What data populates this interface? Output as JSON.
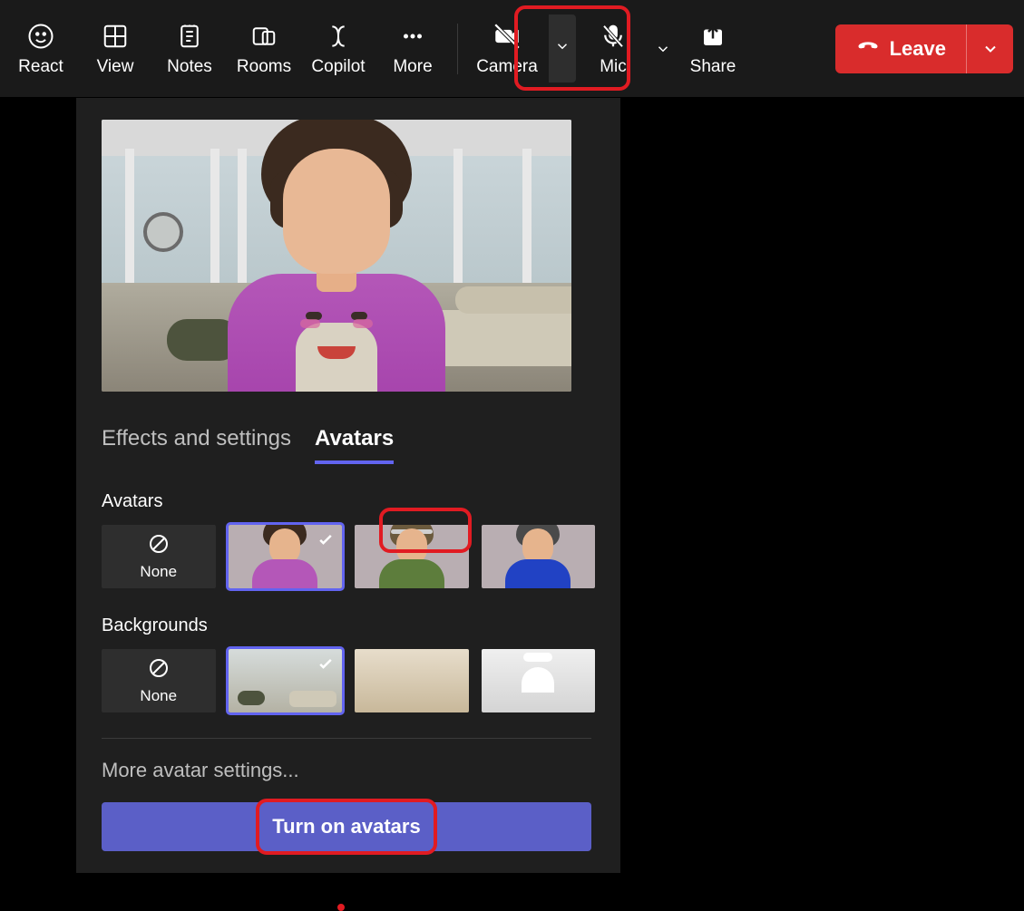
{
  "toolbar": {
    "react": "React",
    "view": "View",
    "notes": "Notes",
    "rooms": "Rooms",
    "copilot": "Copilot",
    "more": "More",
    "camera": "Camera",
    "mic": "Mic",
    "share": "Share",
    "leave": "Leave"
  },
  "panel": {
    "tabs": {
      "effects": "Effects and settings",
      "avatars": "Avatars"
    },
    "sections": {
      "avatars": "Avatars",
      "backgrounds": "Backgrounds"
    },
    "none": "None",
    "more_settings": "More avatar settings...",
    "turn_on": "Turn on avatars"
  }
}
